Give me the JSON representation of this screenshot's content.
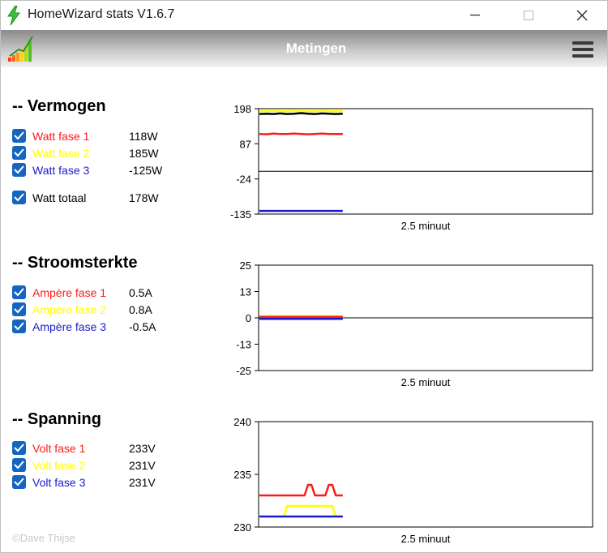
{
  "window": {
    "title": "HomeWizard stats V1.6.7",
    "minimize_icon": "minimize-icon",
    "maximize_icon": "maximize-icon",
    "close_icon": "close-icon"
  },
  "header": {
    "title": "Metingen",
    "menu_icon": "hamburger-menu-icon",
    "logo_icon": "bar-chart-logo-icon"
  },
  "colors": {
    "phase1": "#ff1a1a",
    "phase2": "#ffff00",
    "phase3": "#1a1acc",
    "total": "#000000",
    "checkbox": "#1565c0"
  },
  "sections": [
    {
      "title": "-- Vermogen",
      "rows": [
        {
          "label": "Watt fase 1",
          "value": "118W",
          "checked": true,
          "color": "#ff1a1a"
        },
        {
          "label": "Watt fase 2",
          "value": "185W",
          "checked": true,
          "color": "#ffff00"
        },
        {
          "label": "Watt fase 3",
          "value": "-125W",
          "checked": true,
          "color": "#1a1acc"
        },
        {
          "label": "Watt totaal",
          "value": "178W",
          "checked": true,
          "color": "#000000"
        }
      ]
    },
    {
      "title": "-- Stroomsterkte",
      "rows": [
        {
          "label": "Ampère fase 1",
          "value": "0.5A",
          "checked": true,
          "color": "#ff1a1a"
        },
        {
          "label": "Ampère fase 2",
          "value": "0.8A",
          "checked": true,
          "color": "#ffff00"
        },
        {
          "label": "Ampère fase 3",
          "value": "-0.5A",
          "checked": true,
          "color": "#1a1acc"
        }
      ]
    },
    {
      "title": "-- Spanning",
      "rows": [
        {
          "label": "Volt fase 1",
          "value": "233V",
          "checked": true,
          "color": "#ff1a1a"
        },
        {
          "label": "Volt fase 2",
          "value": "231V",
          "checked": true,
          "color": "#ffff00"
        },
        {
          "label": "Volt fase 3",
          "value": "231V",
          "checked": true,
          "color": "#1a1acc"
        }
      ]
    }
  ],
  "credit": "©Dave Thijse",
  "chart_data": [
    {
      "type": "line",
      "xlabel": "2.5 minuut",
      "ylim": [
        -135,
        198
      ],
      "yticks": [
        "198",
        "87",
        "-24",
        "-135"
      ],
      "zero_line": true,
      "x": [
        0,
        1,
        2,
        3,
        4,
        5,
        6,
        7,
        8,
        9,
        10,
        11,
        12
      ],
      "xlim": [
        0,
        48
      ],
      "series": [
        {
          "color": "#ffff00",
          "values": [
            190,
            190,
            191,
            190,
            190,
            191,
            190,
            190,
            190,
            191,
            190,
            190,
            190
          ]
        },
        {
          "color": "#000000",
          "values": [
            181,
            182,
            181,
            183,
            181,
            182,
            184,
            182,
            181,
            183,
            182,
            181,
            182
          ]
        },
        {
          "color": "#ff1a1a",
          "values": [
            118,
            117,
            119,
            118,
            118,
            119,
            118,
            117,
            118,
            119,
            118,
            118,
            118
          ]
        },
        {
          "color": "#1a1acc",
          "values": [
            -125,
            -125,
            -125,
            -125,
            -125,
            -125,
            -125,
            -125,
            -125,
            -125,
            -125,
            -125,
            -125
          ]
        }
      ]
    },
    {
      "type": "line",
      "xlabel": "2.5 minuut",
      "ylim": [
        -25,
        25
      ],
      "yticks": [
        "25",
        "13",
        "0",
        "-13",
        "-25"
      ],
      "zero_line": true,
      "x": [
        0,
        1,
        2,
        3,
        4,
        5,
        6,
        7,
        8,
        9,
        10,
        11,
        12
      ],
      "xlim": [
        0,
        48
      ],
      "series": [
        {
          "color": "#ffff00",
          "values": [
            0.8,
            0.8,
            0.8,
            0.8,
            0.8,
            0.8,
            0.8,
            0.8,
            0.8,
            0.8,
            0.8,
            0.8,
            0.8
          ]
        },
        {
          "color": "#ff1a1a",
          "values": [
            0.5,
            0.5,
            0.5,
            0.5,
            0.5,
            0.5,
            0.5,
            0.5,
            0.5,
            0.5,
            0.5,
            0.5,
            0.5
          ]
        },
        {
          "color": "#1a1acc",
          "values": [
            -0.5,
            -0.5,
            -0.5,
            -0.5,
            -0.5,
            -0.5,
            -0.5,
            -0.5,
            -0.5,
            -0.5,
            -0.5,
            -0.5,
            -0.5
          ]
        }
      ]
    },
    {
      "type": "line",
      "xlabel": "2.5 minuut",
      "ylim": [
        230,
        240
      ],
      "yticks": [
        "240",
        "235",
        "230"
      ],
      "zero_line": false,
      "x": [
        0,
        1,
        2,
        3,
        4,
        5,
        6,
        7,
        8,
        9,
        10,
        11,
        12,
        13,
        14,
        15,
        16,
        17,
        18,
        19,
        20,
        21,
        22,
        23,
        24
      ],
      "xlim": [
        0,
        96
      ],
      "series": [
        {
          "color": "#ff1a1a",
          "values": [
            233,
            233,
            233,
            233,
            233,
            233,
            233,
            233,
            233,
            233,
            233,
            233,
            233,
            233,
            234,
            234,
            233,
            233,
            233,
            233,
            234,
            234,
            233,
            233,
            233
          ]
        },
        {
          "color": "#ffff00",
          "values": [
            231,
            231,
            231,
            231,
            231,
            231,
            231,
            231,
            232,
            232,
            232,
            232,
            232,
            232,
            232,
            232,
            232,
            232,
            232,
            232,
            232,
            232,
            231,
            231,
            231
          ]
        },
        {
          "color": "#1a1acc",
          "values": [
            231,
            231,
            231,
            231,
            231,
            231,
            231,
            231,
            231,
            231,
            231,
            231,
            231,
            231,
            231,
            231,
            231,
            231,
            231,
            231,
            231,
            231,
            231,
            231,
            231
          ]
        }
      ]
    }
  ]
}
